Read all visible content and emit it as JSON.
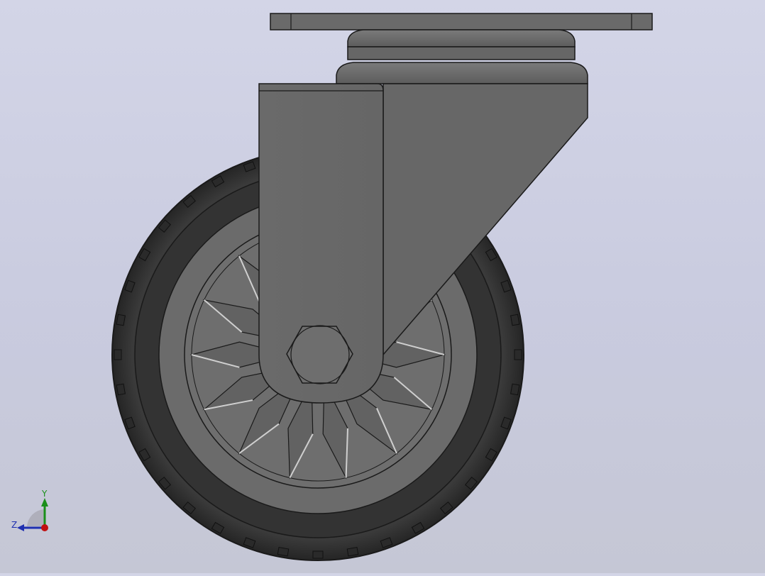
{
  "viewport": {
    "model": "swivel-caster-wheel",
    "background_top": "#d3d5e7",
    "background_bottom": "#c5c7d5"
  },
  "colors": {
    "tire": "#353535",
    "tire_edge": "#1f1f1f",
    "hub": "#6b6b6b",
    "bracket": "#6a6a6a",
    "bracket_light": "#747474",
    "plate": "#6c6c6c",
    "outline": "#1a1a1a"
  },
  "triad": {
    "y_label": "Y",
    "z_label": "Z",
    "y_color": "#1a8f1a",
    "z_color": "#1f2fb0",
    "x_color": "#c01010"
  }
}
